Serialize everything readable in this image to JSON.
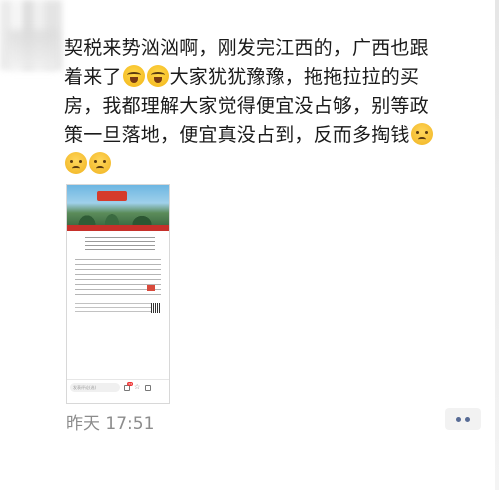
{
  "post": {
    "line1": "契税来势汹汹啊，刚发完江西的，广西也跟",
    "line2_a": "着来了",
    "line2_b": "大家犹犹豫豫，拖拖拉拉的买",
    "line3": "房，我都理解大家觉得便宜没占够，别等政",
    "line4": "策一旦落地，便宜真没占到，反而多掏钱",
    "emojis": [
      "crying-face-icon",
      "crying-face-icon",
      "worried-face-icon"
    ]
  },
  "thumbnail": {
    "search_placeholder": "发表评论(选)",
    "badge_count": "33"
  },
  "footer": {
    "timestamp": "昨天  17:51"
  }
}
